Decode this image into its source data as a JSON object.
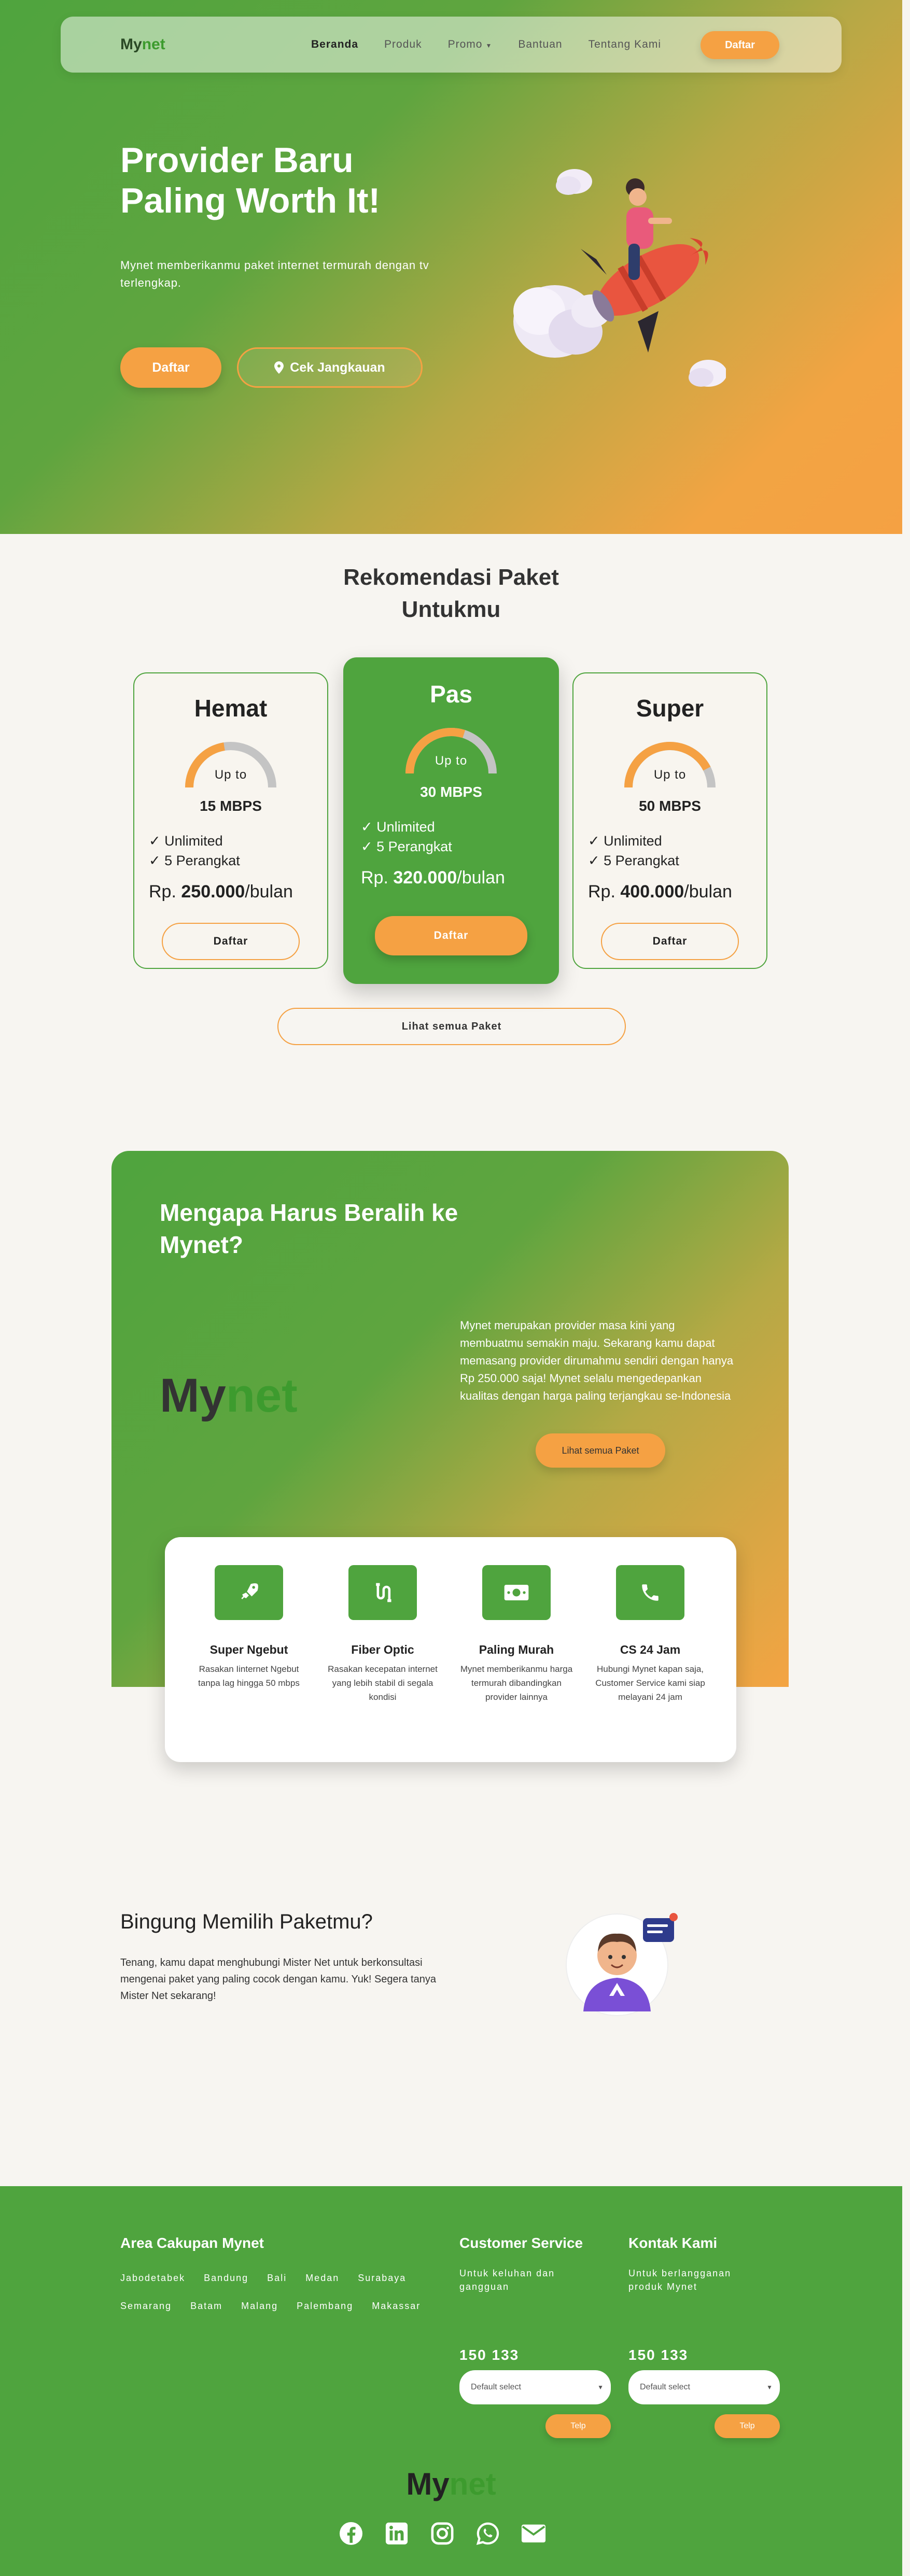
{
  "nav": {
    "brand_a": "My",
    "brand_b": "net",
    "items": [
      "Beranda",
      "Produk",
      "Promo",
      "Bantuan",
      "Tentang Kami"
    ],
    "cta": "Daftar"
  },
  "hero": {
    "title": "Provider Baru Paling Worth It!",
    "subtitle": "Mynet memberikanmu paket internet termurah dengan tv terlengkap.",
    "btn_primary": "Daftar",
    "btn_secondary": "Cek Jangkauan"
  },
  "packages": {
    "title": "Rekomendasi Paket Untukmu",
    "upto": "Up to",
    "items": [
      {
        "name": "Hemat",
        "speed": "15 MBPS",
        "speed_fraction": 0.45,
        "f1": "✓ Unlimited",
        "f2": "✓ 5 Perangkat",
        "price_prefix": "Rp.",
        "price": "250.000",
        "price_suffix": "/bulan",
        "btn": "Daftar"
      },
      {
        "name": "Pas",
        "speed": "30 MBPS",
        "speed_fraction": 0.6,
        "f1": "✓ Unlimited",
        "f2": "✓ 5 Perangkat",
        "price_prefix": "Rp.",
        "price": "320.000",
        "price_suffix": "/bulan",
        "btn": "Daftar"
      },
      {
        "name": "Super",
        "speed": "50 MBPS",
        "speed_fraction": 0.85,
        "f1": "✓ Unlimited",
        "f2": "✓ 5 Perangkat",
        "price_prefix": "Rp.",
        "price": "400.000",
        "price_suffix": "/bulan",
        "btn": "Daftar"
      }
    ],
    "see_all": "Lihat semua Paket"
  },
  "why": {
    "title": "Mengapa Harus Beralih ke Mynet?",
    "logo_a": "My",
    "logo_b": "net",
    "text": "Mynet merupakan provider masa kini yang membuatmu semakin maju. Sekarang kamu dapat memasang provider dirumahmu sendiri dengan hanya Rp 250.000 saja! Mynet selalu mengedepankan kualitas dengan harga paling terjangkau se-Indonesia",
    "btn": "Lihat semua Paket",
    "features": [
      {
        "title": "Super Ngebut",
        "desc": "Rasakan Iinternet Ngebut tanpa lag hingga 50 mbps",
        "icon": "rocket-icon"
      },
      {
        "title": "Fiber Optic",
        "desc": "Rasakan kecepatan internet yang lebih stabil di segala kondisi",
        "icon": "fiber-icon"
      },
      {
        "title": "Paling Murah",
        "desc": "Mynet memberikanmu harga termurah dibandingkan provider lainnya",
        "icon": "money-icon"
      },
      {
        "title": "CS 24 Jam",
        "desc": "Hubungi Mynet kapan saja, Customer Service kami siap melayani 24 jam",
        "icon": "phone-icon"
      }
    ]
  },
  "consult": {
    "title": "Bingung Memilih Paketmu?",
    "text": "Tenang, kamu dapat menghubungi Mister Net untuk berkonsultasi mengenai paket yang paling cocok dengan kamu. Yuk! Segera tanya Mister Net sekarang!"
  },
  "footer": {
    "area_title": "Area Cakupan Mynet",
    "areas": [
      "Jabodetabek",
      "Bandung",
      "Bali",
      "Medan",
      "Surabaya",
      "Semarang",
      "Batam",
      "Malang",
      "Palembang",
      "Makassar"
    ],
    "cs_title": "Customer Service",
    "cs_text": "Untuk keluhan dan gangguan",
    "contact_title": "Kontak Kami",
    "contact_text": "Untuk berlangganan produk Mynet",
    "cs_number": "150 133",
    "contact_number": "150 133",
    "select_default": "Default select",
    "btn": "Telp",
    "logo_a": "My",
    "logo_b": "net"
  },
  "colors": {
    "green": "#4fa43e",
    "orange": "#f5a143"
  }
}
